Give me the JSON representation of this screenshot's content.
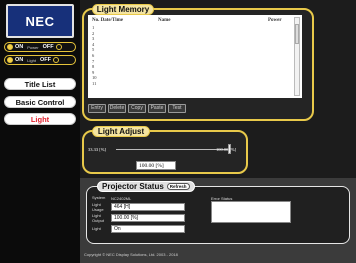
{
  "brand": {
    "logo_text": "NEC"
  },
  "sidebar": {
    "power_toggle": {
      "on": "ON",
      "mid": "Power",
      "off": "OFF"
    },
    "light_toggle": {
      "on": "ON",
      "mid": "Light",
      "off": "OFF"
    },
    "nav": [
      {
        "label": "Title List",
        "active": false
      },
      {
        "label": "Basic Control",
        "active": false
      },
      {
        "label": "Light",
        "active": true
      }
    ]
  },
  "light_memory": {
    "title": "Light Memory",
    "headers": {
      "no_date_time": "No. Date/Time",
      "name": "Name",
      "power": "Power"
    },
    "row_numbers": [
      "1",
      "2",
      "3",
      "4",
      "5",
      "6",
      "7",
      "8",
      "9",
      "10",
      "11"
    ],
    "buttons": [
      "Entry",
      "Delete",
      "Copy",
      "Paste",
      "Test"
    ]
  },
  "light_adjust": {
    "title": "Light Adjust",
    "min_label": "33.33 [%]",
    "max_label": "100.00 [%]",
    "value": "100.00 [%]",
    "level_percent": 100
  },
  "projector_status": {
    "title": "Projector Status",
    "refresh_label": "Refresh",
    "system_label": "System",
    "system_value": "NC2402ML",
    "light_usage_label": "Light Usage",
    "light_usage_value": "464 [H]",
    "light_output_label": "Light Output",
    "light_output_value": "100.00 [%]",
    "light_label": "Light",
    "light_value": "On",
    "error_status_label": "Error Status"
  },
  "footer": {
    "copyright": "Copyright © NEC Display Solutions, Ltd. 2003 - 2018"
  },
  "colors": {
    "accent": "#e8c94a",
    "logo_bg": "#17307a",
    "active_nav": "#e0202c"
  }
}
